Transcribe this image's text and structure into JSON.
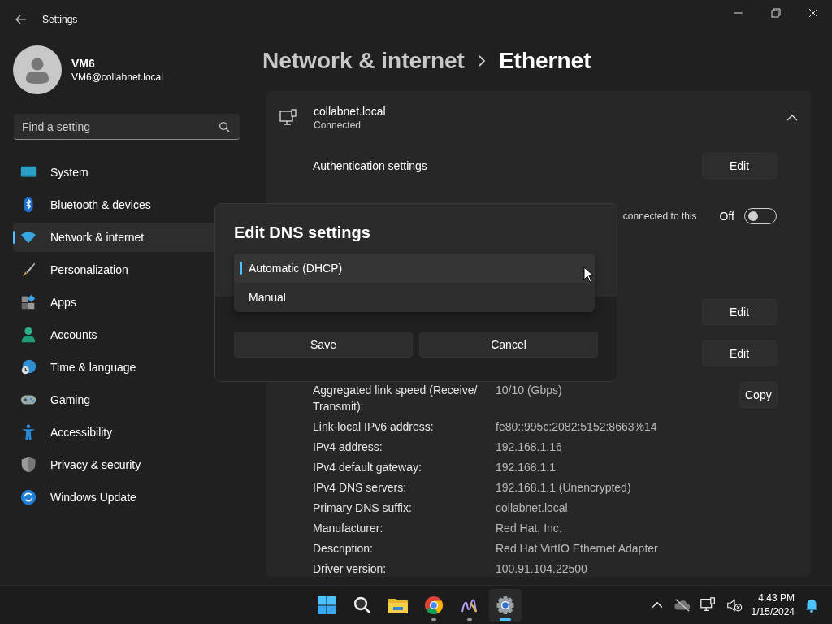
{
  "window": {
    "title": "Settings"
  },
  "user": {
    "name": "VM6",
    "email": "VM6@collabnet.local"
  },
  "search": {
    "placeholder": "Find a setting"
  },
  "nav": [
    {
      "label": "System",
      "selected": false
    },
    {
      "label": "Bluetooth & devices",
      "selected": false
    },
    {
      "label": "Network & internet",
      "selected": true
    },
    {
      "label": "Personalization",
      "selected": false
    },
    {
      "label": "Apps",
      "selected": false
    },
    {
      "label": "Accounts",
      "selected": false
    },
    {
      "label": "Time & language",
      "selected": false
    },
    {
      "label": "Gaming",
      "selected": false
    },
    {
      "label": "Accessibility",
      "selected": false
    },
    {
      "label": "Privacy & security",
      "selected": false
    },
    {
      "label": "Windows Update",
      "selected": false
    }
  ],
  "breadcrumb": [
    "Network & internet",
    "Ethernet"
  ],
  "card": {
    "name": "collabnet.local",
    "status": "Connected",
    "expanded": true,
    "rows": [
      {
        "kind": "button",
        "label": "Authentication settings",
        "button": "Edit"
      },
      {
        "kind": "toggle",
        "note": "connected to this",
        "state_label": "Off",
        "on": false
      },
      {
        "kind": "blank"
      },
      {
        "kind": "button",
        "button": "Edit"
      },
      {
        "kind": "button",
        "button": "Edit"
      }
    ],
    "details": [
      {
        "label": "Aggregated link speed (Receive/ Transmit):",
        "value": "10/10 (Gbps)"
      },
      {
        "label": "Link-local IPv6 address:",
        "value": "fe80::995c:2082:5152:8663%14"
      },
      {
        "label": "IPv4 address:",
        "value": "192.168.1.16"
      },
      {
        "label": "IPv4 default gateway:",
        "value": "192.168.1.1"
      },
      {
        "label": "IPv4 DNS servers:",
        "value": "192.168.1.1 (Unencrypted)"
      },
      {
        "label": "Primary DNS suffix:",
        "value": "collabnet.local"
      },
      {
        "label": "Manufacturer:",
        "value": "Red Hat, Inc."
      },
      {
        "label": "Description:",
        "value": "Red Hat VirtIO Ethernet Adapter"
      },
      {
        "label": "Driver version:",
        "value": "100.91.104.22500"
      }
    ],
    "copy_button": "Copy"
  },
  "dialog": {
    "title": "Edit DNS settings",
    "options": [
      {
        "label": "Automatic (DHCP)",
        "selected": true
      },
      {
        "label": "Manual",
        "selected": false
      }
    ],
    "buttons": [
      "Save",
      "Cancel"
    ]
  },
  "taskbar": {
    "time": "4:43 PM",
    "date": "1/15/2024"
  }
}
